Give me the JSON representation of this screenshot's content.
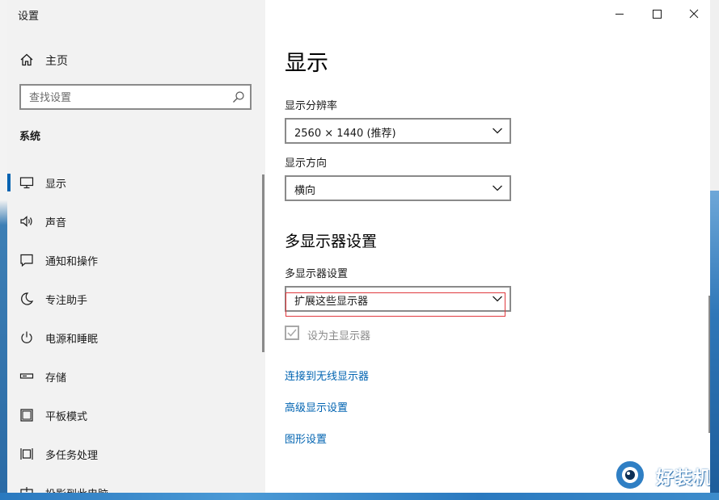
{
  "window": {
    "title": "设置",
    "controls": {
      "minimize": "minimize-icon",
      "maximize": "maximize-icon",
      "close": "close-icon"
    }
  },
  "sidebar": {
    "home_label": "主页",
    "search_placeholder": "查找设置",
    "section_label": "系统",
    "items": [
      {
        "label": "显示",
        "icon": "monitor-icon",
        "active": true
      },
      {
        "label": "声音",
        "icon": "speaker-icon",
        "active": false
      },
      {
        "label": "通知和操作",
        "icon": "notification-icon",
        "active": false
      },
      {
        "label": "专注助手",
        "icon": "moon-icon",
        "active": false
      },
      {
        "label": "电源和睡眠",
        "icon": "power-icon",
        "active": false
      },
      {
        "label": "存储",
        "icon": "storage-icon",
        "active": false
      },
      {
        "label": "平板模式",
        "icon": "tablet-icon",
        "active": false
      },
      {
        "label": "多任务处理",
        "icon": "multitask-icon",
        "active": false
      },
      {
        "label": "投影到此电脑",
        "icon": "project-icon",
        "active": false
      }
    ]
  },
  "main": {
    "title": "显示",
    "resolution": {
      "label": "显示分辨率",
      "value": "2560 × 1440 (推荐)"
    },
    "orientation": {
      "label": "显示方向",
      "value": "横向"
    },
    "multi_display": {
      "section_title": "多显示器设置",
      "label": "多显示器设置",
      "value": "扩展这些显示器",
      "checkbox_label": "设为主显示器",
      "checkbox_checked": true,
      "checkbox_disabled": true
    },
    "links": [
      "连接到无线显示器",
      "高级显示设置",
      "图形设置"
    ]
  },
  "watermark": {
    "text": "好装机"
  },
  "colors": {
    "accent": "#0063b1",
    "link": "#0063b1",
    "highlight": "#e0393e",
    "sidebar_bg": "#f2f2f2"
  }
}
